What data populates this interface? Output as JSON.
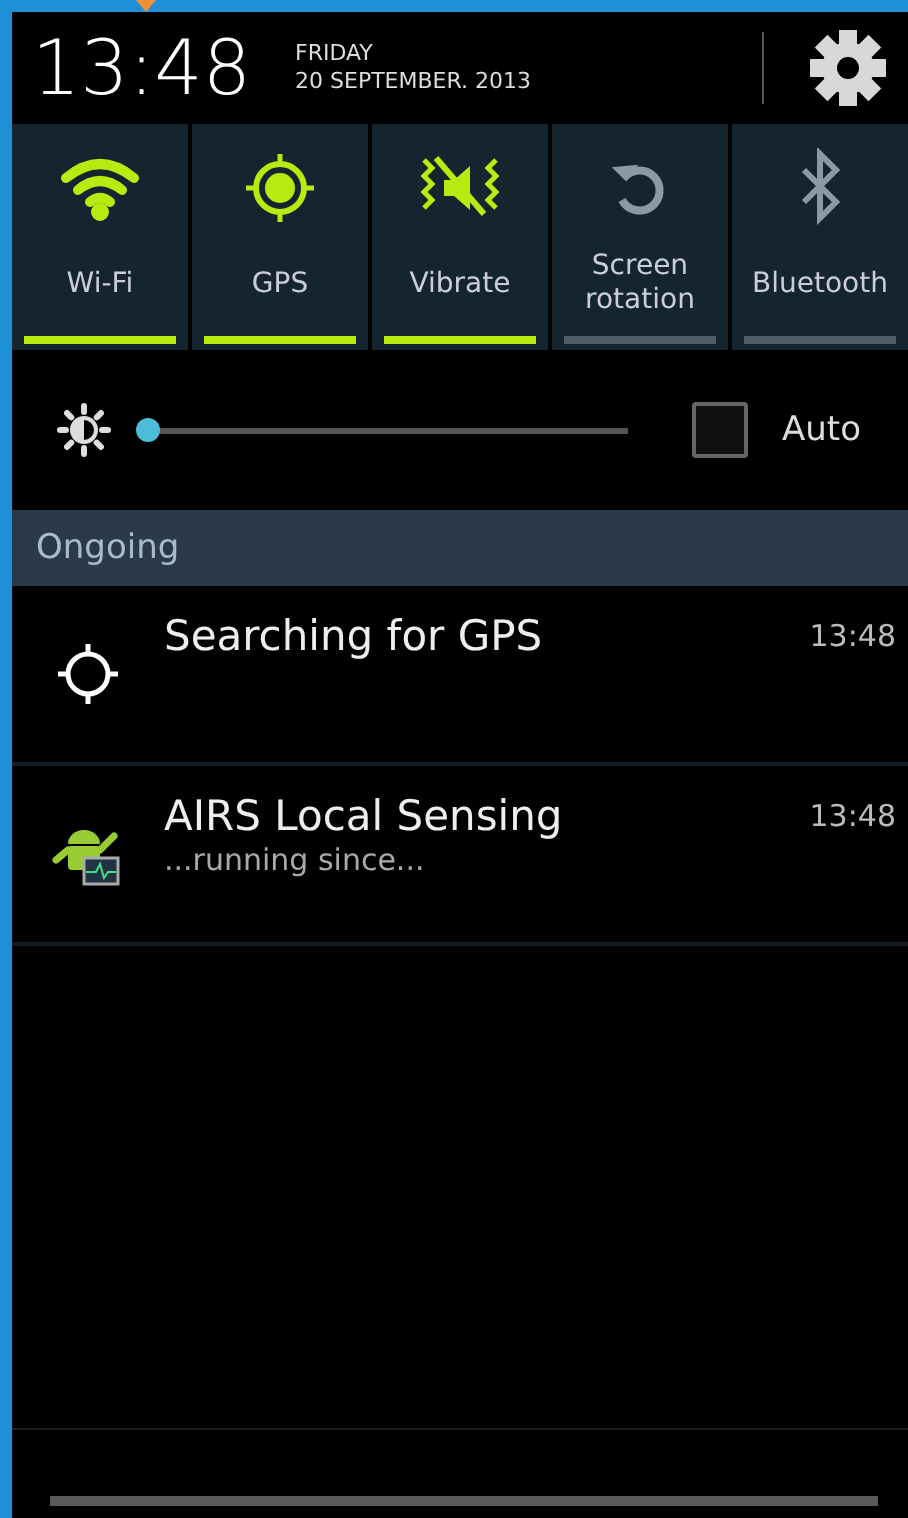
{
  "header": {
    "time": "13:48",
    "day": "FRIDAY",
    "date": "20 SEPTEMBER. 2013"
  },
  "toggles": [
    {
      "kind": "wifi",
      "label": "Wi-Fi",
      "on": true
    },
    {
      "kind": "gps",
      "label": "GPS",
      "on": true
    },
    {
      "kind": "vibrate",
      "label": "Vibrate",
      "on": true
    },
    {
      "kind": "rotation",
      "label": "Screen rotation",
      "on": false
    },
    {
      "kind": "bluetooth",
      "label": "Bluetooth",
      "on": false
    }
  ],
  "brightness": {
    "level": 0.0,
    "auto_label": "Auto",
    "auto_checked": false
  },
  "section": {
    "title": "Ongoing"
  },
  "notifications": [
    {
      "kind": "gps",
      "title": "Searching for GPS",
      "time": "13:48"
    },
    {
      "kind": "app",
      "title": "AIRS Local Sensing",
      "subtitle": "...running since...",
      "time": "13:48"
    }
  ]
}
